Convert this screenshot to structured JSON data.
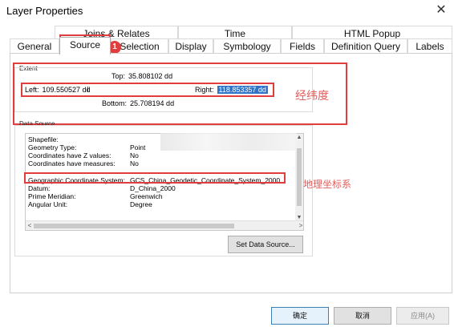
{
  "window": {
    "title": "Layer Properties",
    "close_glyph": "✕"
  },
  "tabs_row1": [
    "Joins & Relates",
    "Time",
    "HTML Popup"
  ],
  "tabs_row2": [
    "General",
    "Source",
    "Selection",
    "Display",
    "Symbology",
    "Fields",
    "Definition Query",
    "Labels"
  ],
  "active_tab": "Source",
  "badge": "1",
  "extent": {
    "group_label": "Extent",
    "top": {
      "label": "Top:",
      "value": "35.808102 dd"
    },
    "left": {
      "label": "Left:",
      "value": "109.550527 dd"
    },
    "right": {
      "label": "Right:",
      "value": "118.853357 dd"
    },
    "bottom": {
      "label": "Bottom:",
      "value": "25.708194 dd"
    }
  },
  "annotations": {
    "extent_note": "经纬度",
    "gcs_note": "地理坐标系"
  },
  "data_source": {
    "group_label": "Data Source",
    "rows": [
      {
        "key": "Shapefile:",
        "value": ""
      },
      {
        "key": "Geometry Type:",
        "value": "Point"
      },
      {
        "key": "Coordinates have Z values:",
        "value": "No"
      },
      {
        "key": "Coordinates have measures:",
        "value": "No"
      },
      {
        "key": "",
        "value": ""
      },
      {
        "key": "Geographic Coordinate System:",
        "value": "GCS_China_Geodetic_Coordinate_System_2000"
      },
      {
        "key": "Datum:",
        "value": "D_China_2000"
      },
      {
        "key": "Prime Meridian:",
        "value": "Greenwich"
      },
      {
        "key": "Angular Unit:",
        "value": "Degree"
      }
    ],
    "set_button": "Set Data Source..."
  },
  "buttons": {
    "ok": "确定",
    "cancel": "取消",
    "apply": "应用(A)"
  },
  "colors": {
    "annotation_red": "#e03e3e",
    "selection_blue": "#2f74c8"
  }
}
